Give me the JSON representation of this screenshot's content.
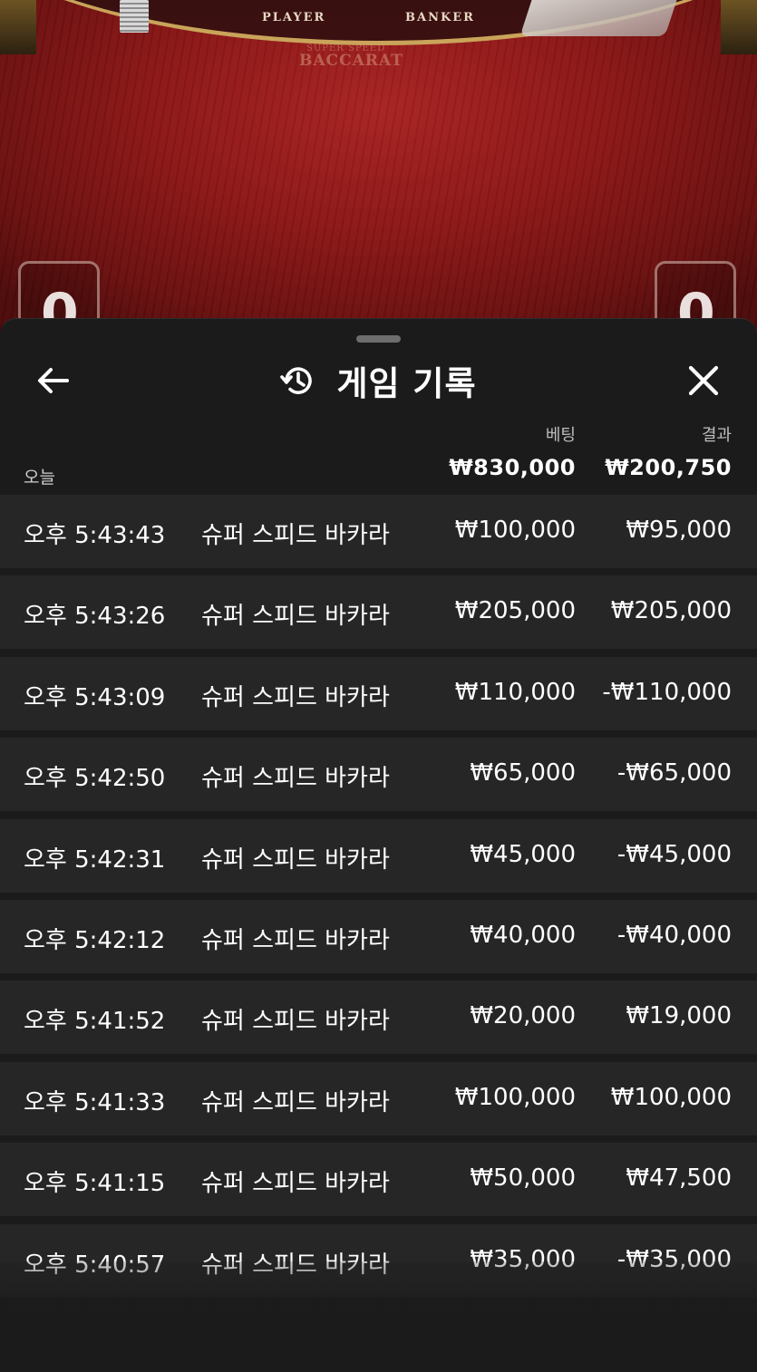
{
  "table": {
    "player_label": "PLAYER",
    "banker_label": "BANKER",
    "logo_sub": "SUPER SPEED",
    "logo_main": "BACCARAT",
    "player_score": "0",
    "banker_score": "0"
  },
  "sheet": {
    "title": "게임 기록",
    "icons": {
      "back": "arrow-left-icon",
      "history": "history-clock-icon",
      "close": "close-x-icon"
    },
    "summary": {
      "day_label": "오늘",
      "bet_header": "베팅",
      "result_header": "결과",
      "total_bet": "₩830,000",
      "total_result": "₩200,750"
    },
    "rows": [
      {
        "time": "오후 5:43:43",
        "game": "슈퍼 스피드 바카라",
        "bet": "₩100,000",
        "result": "₩95,000"
      },
      {
        "time": "오후 5:43:26",
        "game": "슈퍼 스피드 바카라",
        "bet": "₩205,000",
        "result": "₩205,000"
      },
      {
        "time": "오후 5:43:09",
        "game": "슈퍼 스피드 바카라",
        "bet": "₩110,000",
        "result": "-₩110,000"
      },
      {
        "time": "오후 5:42:50",
        "game": "슈퍼 스피드 바카라",
        "bet": "₩65,000",
        "result": "-₩65,000"
      },
      {
        "time": "오후 5:42:31",
        "game": "슈퍼 스피드 바카라",
        "bet": "₩45,000",
        "result": "-₩45,000"
      },
      {
        "time": "오후 5:42:12",
        "game": "슈퍼 스피드 바카라",
        "bet": "₩40,000",
        "result": "-₩40,000"
      },
      {
        "time": "오후 5:41:52",
        "game": "슈퍼 스피드 바카라",
        "bet": "₩20,000",
        "result": "₩19,000"
      },
      {
        "time": "오후 5:41:33",
        "game": "슈퍼 스피드 바카라",
        "bet": "₩100,000",
        "result": "₩100,000"
      },
      {
        "time": "오후 5:41:15",
        "game": "슈퍼 스피드 바카라",
        "bet": "₩50,000",
        "result": "₩47,500"
      },
      {
        "time": "오후 5:40:57",
        "game": "슈퍼 스피드 바카라",
        "bet": "₩35,000",
        "result": "-₩35,000"
      }
    ],
    "colors": {
      "sheet_bg": "#1b1b1b",
      "row_bg": "#262626",
      "text": "#ffffff",
      "muted": "#bdbdbd"
    }
  }
}
